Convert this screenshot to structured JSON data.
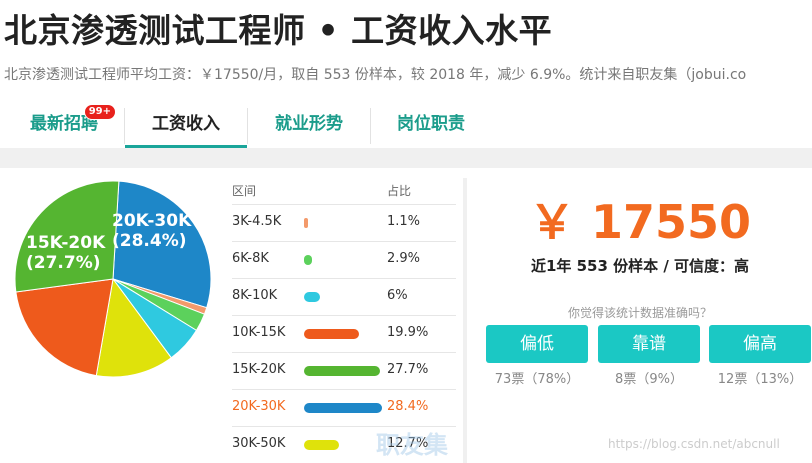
{
  "header": {
    "title": "北京渗透测试工程师 • 工资收入水平",
    "summary": "北京渗透测试工程师平均工资：￥17550/月，取自 553 份样本，较 2018 年，减少 6.9%。统计来自职友集（jobui.co"
  },
  "tabs": [
    {
      "label": "最新招聘",
      "badge": "99+"
    },
    {
      "label": "工资收入"
    },
    {
      "label": "就业形势"
    },
    {
      "label": "岗位职责"
    }
  ],
  "distribution": {
    "col_range": "区间",
    "col_pct": "占比",
    "rows": [
      {
        "range": "3K-4.5K",
        "pct": "1.1%",
        "value": 1.1,
        "color": "#f39a6b"
      },
      {
        "range": "6K-8K",
        "pct": "2.9%",
        "value": 2.9,
        "color": "#5cd15c"
      },
      {
        "range": "8K-10K",
        "pct": "6%",
        "value": 6,
        "color": "#2fc9e0"
      },
      {
        "range": "10K-15K",
        "pct": "19.9%",
        "value": 19.9,
        "color": "#ee5a1c"
      },
      {
        "range": "15K-20K",
        "pct": "27.7%",
        "value": 27.7,
        "color": "#55b531"
      },
      {
        "range": "20K-30K",
        "pct": "28.4%",
        "value": 28.4,
        "color": "#1e87c8"
      },
      {
        "range": "30K-50K",
        "pct": "12.7%",
        "value": 12.7,
        "color": "#dfe20b"
      }
    ]
  },
  "pie": {
    "label_a": {
      "range": "20K-30K",
      "pct": "(28.4%)"
    },
    "label_b": {
      "range": "15K-20K",
      "pct": "(27.7%)"
    }
  },
  "salary": {
    "amount": "￥ 17550",
    "sample": "近1年 553 份样本 / 可信度：高",
    "question": "你觉得该统计数据准确吗？"
  },
  "votes": [
    {
      "label": "偏低",
      "count": "73票（78%）"
    },
    {
      "label": "靠谱",
      "count": "8票（9%）"
    },
    {
      "label": "偏高",
      "count": "12票（13%）"
    }
  ],
  "watermark": {
    "logo": "职友集",
    "url": "https://blog.csdn.net/abcnull"
  }
}
